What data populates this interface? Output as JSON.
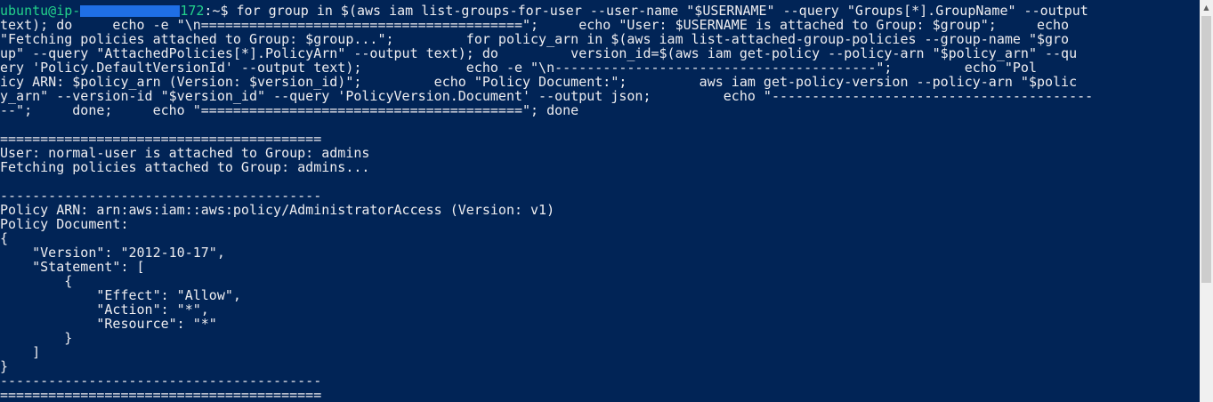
{
  "terminal": {
    "prompt": {
      "user_host_prefix": "ubuntu@ip-",
      "redacted_host_suffix": "172",
      "path_and_symbol": ":~$ "
    },
    "command_lines": [
      "for group in $(aws iam list-groups-for-user --user-name \"$USERNAME\" --query \"Groups[*].GroupName\" --output",
      "text); do     echo -e \"\\n========================================\";     echo \"User: $USERNAME is attached to Group: $group\";     echo",
      "\"Fetching policies attached to Group: $group...\";         for policy_arn in $(aws iam list-attached-group-policies --group-name \"$gro",
      "up\" --query \"AttachedPolicies[*].PolicyArn\" --output text); do         version_id=$(aws iam get-policy --policy-arn \"$policy_arn\" --qu",
      "ery 'Policy.DefaultVersionId' --output text);             echo -e \"\\n----------------------------------------\";         echo \"Pol",
      "icy ARN: $policy_arn (Version: $version_id)\";         echo \"Policy Document:\";         aws iam get-policy-version --policy-arn \"$polic",
      "y_arn\" --version-id \"$version_id\" --query 'PolicyVersion.Document' --output json;         echo \"----------------------------------------",
      "--\";     done;     echo \"========================================\"; done"
    ],
    "output_lines": [
      "",
      "========================================",
      "User: normal-user is attached to Group: admins",
      "Fetching policies attached to Group: admins...",
      "",
      "----------------------------------------",
      "Policy ARN: arn:aws:iam::aws:policy/AdministratorAccess (Version: v1)",
      "Policy Document:",
      "{",
      "    \"Version\": \"2012-10-17\",",
      "    \"Statement\": [",
      "        {",
      "            \"Effect\": \"Allow\",",
      "            \"Action\": \"*\",",
      "            \"Resource\": \"*\"",
      "        }",
      "    ]",
      "}",
      "----------------------------------------",
      "========================================"
    ],
    "colors": {
      "background": "#012456",
      "foreground": "#eeedf0",
      "prompt": "#23d18b",
      "redaction": "#1f6fe5"
    }
  },
  "scrollbar": {
    "up_arrow_icon": "triangle-up-icon"
  }
}
